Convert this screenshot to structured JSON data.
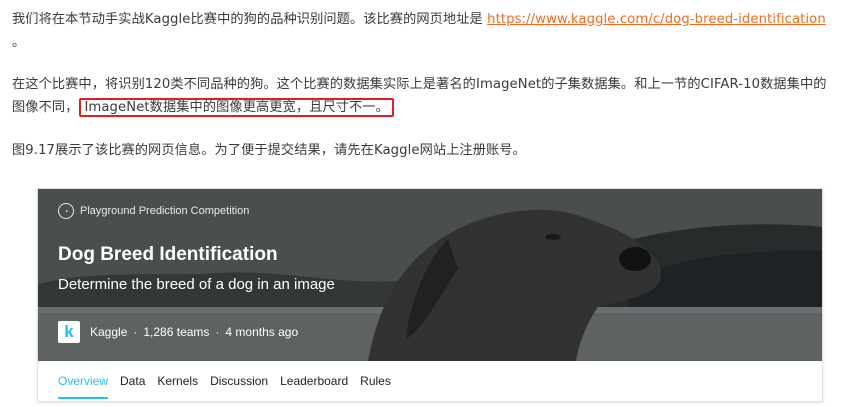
{
  "paragraphs": {
    "p1_text": "我们将在本节动手实战Kaggle比赛中的狗的品种识别问题。该比赛的网页地址是 ",
    "p1_link": "https://www.kaggle.com/c/dog-breed-identification",
    "p1_end": " 。",
    "p2_text": "在这个比赛中，将识别120类不同品种的狗。这个比赛的数据集实际上是著名的ImageNet的子集数据集。和上一节的CIFAR-10数据集中的图像不同，",
    "p2_highlight": "ImageNet数据集中的图像更高更宽，且尺寸不一。",
    "p3_text": "图9.17展示了该比赛的网页信息。为了便于提交结果，请先在Kaggle网站上注册账号。"
  },
  "card": {
    "competition_type": "Playground Prediction Competition",
    "title": "Dog Breed Identification",
    "subtitle": "Determine the breed of a dog in an image",
    "host": "Kaggle",
    "teams": "1,286 teams",
    "age": "4 months ago",
    "separator": "·",
    "logo_letter": "k",
    "tabs": [
      {
        "label": "Overview",
        "active": true
      },
      {
        "label": "Data",
        "active": false
      },
      {
        "label": "Kernels",
        "active": false
      },
      {
        "label": "Discussion",
        "active": false
      },
      {
        "label": "Leaderboard",
        "active": false
      },
      {
        "label": "Rules",
        "active": false
      }
    ]
  },
  "colors": {
    "link": "#f46a1d",
    "highlight_border": "#e02020",
    "kaggle_blue": "#20beff"
  }
}
